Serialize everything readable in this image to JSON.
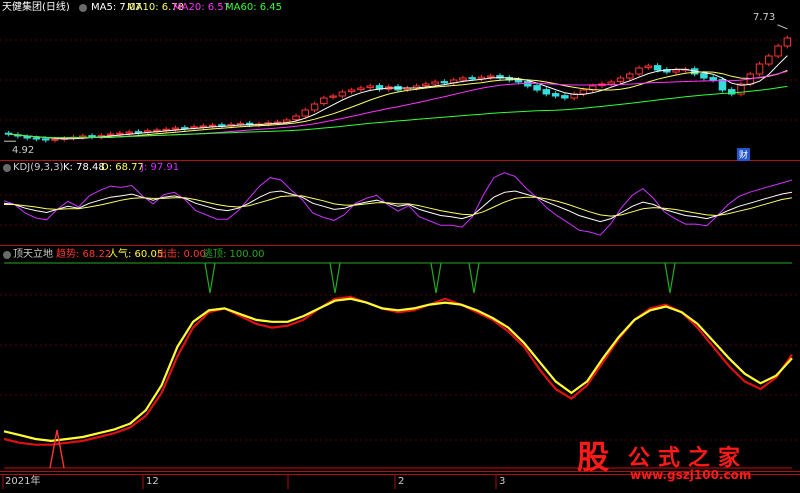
{
  "panel1": {
    "stock_title": "天健集团(日线)",
    "ma": [
      {
        "label": "MA5: 7.07",
        "color": "#ffffff"
      },
      {
        "label": "MA10: 6.78",
        "color": "#ffff66"
      },
      {
        "label": "MA20: 6.57",
        "color": "#ff33ff"
      },
      {
        "label": "MA60: 6.45",
        "color": "#33ff33"
      }
    ],
    "high_label": "7.73",
    "low_label": "4.92",
    "finance_tag": "财"
  },
  "panel2": {
    "title": "KDJ(9,3,3)",
    "k_label": "K: 78.48",
    "d_label": "D: 68.77",
    "j_label": "J: 97.91",
    "k_color": "#ffffff",
    "d_color": "#ffff66",
    "j_color": "#cc33ff"
  },
  "panel3": {
    "title": "顶天立地",
    "items": [
      {
        "label": "趋势: 68.22",
        "color": "#ff3333"
      },
      {
        "label": "人气: 60.05",
        "color": "#ffff33"
      },
      {
        "label": "出击: 0.00",
        "color": "#ff3333"
      },
      {
        "label": "逃顶: 100.00",
        "color": "#22aa22"
      }
    ]
  },
  "xaxis": {
    "labels": [
      "2021年",
      "12",
      "2",
      "3"
    ]
  },
  "watermark": {
    "logo_char": "股",
    "site_name": "公式之家",
    "url": "www.gszj100.com"
  },
  "chart_data": [
    {
      "type": "candlestick",
      "name": "price",
      "ylim": [
        4.5,
        8.0
      ],
      "markers": {
        "high": 7.73,
        "low": 4.92
      },
      "close": [
        5.1,
        5.05,
        5.0,
        4.98,
        4.95,
        4.97,
        4.99,
        5.02,
        5.05,
        5.03,
        5.06,
        5.1,
        5.12,
        5.15,
        5.14,
        5.18,
        5.2,
        5.22,
        5.25,
        5.24,
        5.28,
        5.3,
        5.32,
        5.3,
        5.34,
        5.36,
        5.33,
        5.35,
        5.38,
        5.4,
        5.45,
        5.55,
        5.7,
        5.85,
        6.0,
        6.05,
        6.15,
        6.2,
        6.25,
        6.3,
        6.22,
        6.28,
        6.2,
        6.25,
        6.3,
        6.35,
        6.4,
        6.38,
        6.45,
        6.5,
        6.48,
        6.52,
        6.55,
        6.5,
        6.45,
        6.4,
        6.3,
        6.2,
        6.1,
        6.05,
        6.0,
        6.1,
        6.2,
        6.3,
        6.35,
        6.4,
        6.5,
        6.6,
        6.75,
        6.8,
        6.7,
        6.65,
        6.7,
        6.72,
        6.6,
        6.5,
        6.45,
        6.2,
        6.1,
        6.35,
        6.6,
        6.85,
        7.05,
        7.3,
        7.5
      ],
      "open": [
        5.12,
        5.08,
        5.03,
        5.0,
        4.98,
        4.95,
        4.97,
        5.0,
        5.02,
        5.06,
        5.03,
        5.07,
        5.1,
        5.12,
        5.16,
        5.15,
        5.18,
        5.2,
        5.22,
        5.26,
        5.25,
        5.28,
        5.3,
        5.33,
        5.3,
        5.33,
        5.37,
        5.33,
        5.35,
        5.38,
        5.4,
        5.46,
        5.55,
        5.7,
        5.86,
        6.02,
        6.05,
        6.16,
        6.21,
        6.26,
        6.31,
        6.22,
        6.29,
        6.21,
        6.25,
        6.31,
        6.35,
        6.41,
        6.38,
        6.45,
        6.51,
        6.48,
        6.52,
        6.56,
        6.51,
        6.46,
        6.41,
        6.31,
        6.21,
        6.11,
        6.06,
        6.0,
        6.1,
        6.2,
        6.31,
        6.35,
        6.41,
        6.5,
        6.6,
        6.76,
        6.81,
        6.71,
        6.65,
        6.7,
        6.73,
        6.61,
        6.51,
        6.46,
        6.21,
        6.1,
        6.35,
        6.6,
        6.85,
        7.05,
        7.3
      ]
    },
    {
      "type": "line",
      "name": "KDJ",
      "ylim": [
        0,
        100
      ],
      "series": [
        {
          "name": "K",
          "values": [
            60,
            58,
            52,
            48,
            45,
            50,
            55,
            52,
            60,
            65,
            70,
            72,
            75,
            70,
            65,
            70,
            72,
            68,
            60,
            55,
            50,
            48,
            52,
            60,
            70,
            78,
            80,
            75,
            70,
            60,
            55,
            50,
            52,
            58,
            62,
            65,
            60,
            55,
            58,
            50,
            45,
            40,
            38,
            35,
            40,
            55,
            70,
            78,
            80,
            75,
            70,
            62,
            55,
            48,
            40,
            35,
            30,
            35,
            45,
            55,
            62,
            58,
            50,
            45,
            40,
            38,
            35,
            40,
            48,
            55,
            60,
            65,
            70,
            75,
            78
          ]
        },
        {
          "name": "D",
          "values": [
            58,
            58,
            56,
            54,
            51,
            50,
            51,
            51,
            54,
            57,
            61,
            65,
            68,
            69,
            68,
            68,
            69,
            69,
            66,
            62,
            58,
            55,
            54,
            56,
            61,
            66,
            71,
            72,
            72,
            68,
            64,
            59,
            57,
            57,
            59,
            61,
            61,
            59,
            59,
            56,
            52,
            48,
            45,
            42,
            41,
            46,
            54,
            62,
            68,
            70,
            70,
            67,
            63,
            58,
            52,
            46,
            41,
            39,
            41,
            46,
            51,
            53,
            52,
            50,
            47,
            44,
            41,
            40,
            43,
            47,
            51,
            56,
            61,
            66,
            69
          ]
        },
        {
          "name": "J",
          "values": [
            64,
            58,
            44,
            36,
            33,
            50,
            63,
            54,
            72,
            81,
            88,
            86,
            89,
            72,
            59,
            74,
            78,
            66,
            48,
            41,
            34,
            34,
            48,
            68,
            88,
            102,
            98,
            81,
            66,
            44,
            37,
            32,
            42,
            60,
            68,
            73,
            58,
            47,
            56,
            38,
            31,
            24,
            24,
            21,
            38,
            73,
            102,
            110,
            104,
            85,
            70,
            52,
            39,
            28,
            16,
            13,
            8,
            27,
            53,
            73,
            84,
            68,
            46,
            35,
            26,
            26,
            23,
            40,
            58,
            71,
            78,
            83,
            88,
            93,
            98
          ]
        }
      ]
    },
    {
      "type": "line",
      "name": "顶天立地",
      "ylim": [
        0,
        100
      ],
      "series": [
        {
          "name": "趋势",
          "values": [
            12,
            10,
            9,
            9,
            10,
            11,
            13,
            15,
            18,
            24,
            36,
            55,
            70,
            78,
            80,
            76,
            72,
            70,
            71,
            74,
            80,
            85,
            86,
            83,
            80,
            78,
            79,
            82,
            85,
            82,
            78,
            74,
            68,
            60,
            48,
            38,
            33,
            40,
            52,
            64,
            74,
            80,
            82,
            78,
            70,
            60,
            50,
            42,
            38,
            44,
            56
          ]
        },
        {
          "name": "人气",
          "values": [
            16,
            14,
            12,
            11,
            12,
            13,
            15,
            17,
            20,
            27,
            40,
            60,
            73,
            79,
            80,
            77,
            74,
            73,
            73,
            76,
            80,
            84,
            85,
            83,
            80,
            79,
            80,
            82,
            83,
            82,
            79,
            75,
            70,
            62,
            52,
            42,
            36,
            42,
            54,
            65,
            74,
            79,
            81,
            78,
            72,
            63,
            54,
            46,
            41,
            45,
            54
          ]
        }
      ],
      "escape_signals_count": 5,
      "attack_signals_count": 1
    }
  ]
}
